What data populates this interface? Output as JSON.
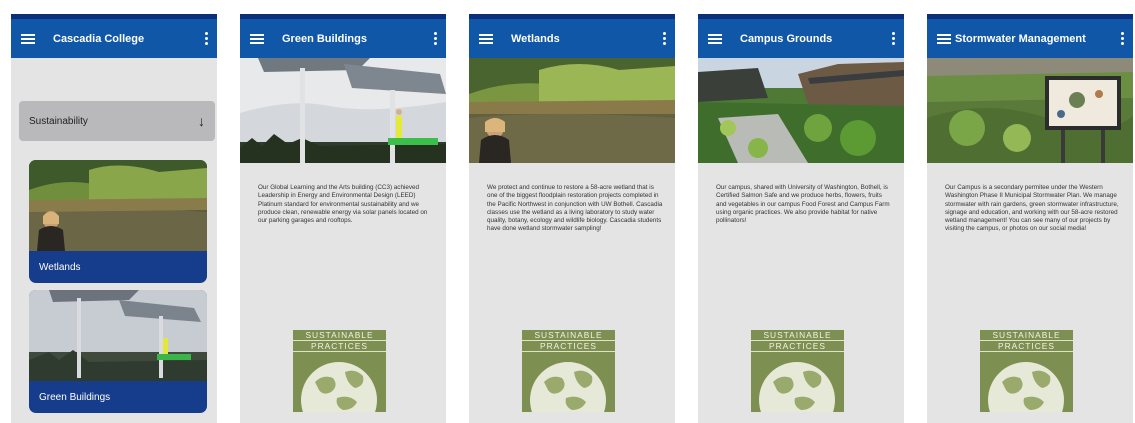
{
  "colors": {
    "topbar": "#1157a8",
    "topbar_edge": "#0b2f7a",
    "screen_bg": "#e4e4e4",
    "card_label_bg": "#163c8c",
    "badge_green": "#7e8f52"
  },
  "icons": {
    "menu": "hamburger-menu-icon",
    "overflow": "three-dot-overflow-icon",
    "dropdown": "down-arrow-icon"
  },
  "screens": [
    {
      "title": "Cascadia College",
      "dropdown_label": "Sustainability",
      "cards": [
        {
          "label": "Wetlands"
        },
        {
          "label": "Green Buildings"
        }
      ]
    },
    {
      "title": "Green Buildings",
      "body": "Our Global Learning and the Arts building (CC3) achieved Leadership in Energy and Environmental Design (LEED) Platinum standard for environmental sustainability and we produce clean, renewable energy via solar panels located on our parking garages and rooftops.",
      "badge_top": "SUSTAINABLE",
      "badge_bottom": "PRACTICES"
    },
    {
      "title": "Wetlands",
      "body": "We protect and continue to restore a 58-acre wetland that is one of the biggest floodplain restoration projects completed in the Pacific Northwest in conjunction with UW Bothell. Cascadia classes use the wetland as a living laboratory to study water quality, botany, ecology and wildlife biology. Cascadia students have done wetland stormwater sampling!",
      "badge_top": "SUSTAINABLE",
      "badge_bottom": "PRACTICES"
    },
    {
      "title": "Campus Grounds",
      "body": "Our campus, shared with University of Washington, Bothell, is Certified Salmon Safe and we produce herbs, flowers, fruits and vegetables in our campus Food Forest and Campus Farm using organic practices. We also provide habitat for native pollinators!",
      "badge_top": "SUSTAINABLE",
      "badge_bottom": "PRACTICES"
    },
    {
      "title": "Stormwater Management",
      "body": "Our Campus is a secondary permitee under the Western Washington Phase II Municipal Stormwater Plan. We manage stormwater with rain gardens, green stormwater infrastructure, signage and education, and working with our 58-acre restored wetland management! You can see many of our projects by visiting the campus, or photos on our social media!",
      "badge_top": "SUSTAINABLE",
      "badge_bottom": "PRACTICES"
    }
  ]
}
